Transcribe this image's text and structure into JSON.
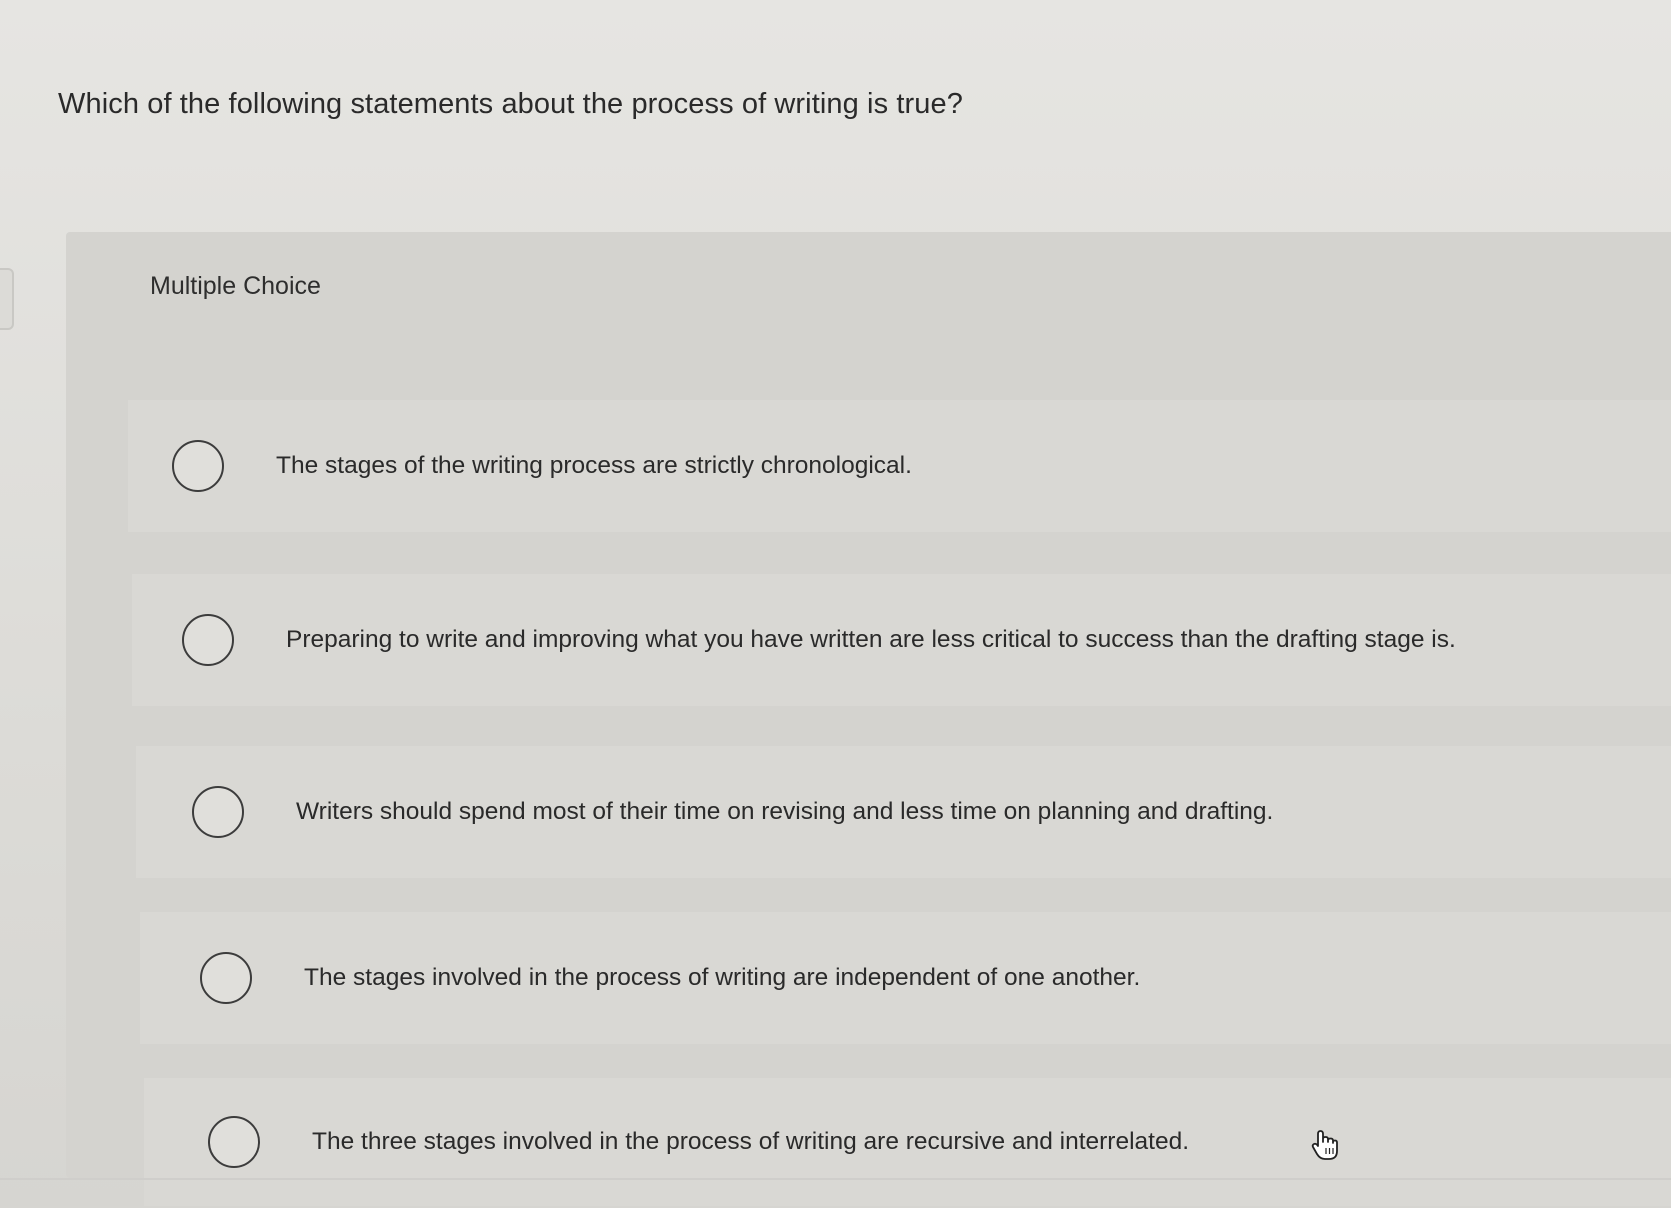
{
  "question": {
    "text": "Which of the following statements about the process of writing is true?"
  },
  "panel": {
    "label": "Multiple Choice"
  },
  "options": [
    {
      "text": "The stages of the writing process are strictly chronological."
    },
    {
      "text": "Preparing to write and improving what you have written are less critical to success than the drafting stage is."
    },
    {
      "text": "Writers should spend most of their time on revising and less time on planning and drafting."
    },
    {
      "text": "The stages involved in the process of writing are independent of one another."
    },
    {
      "text": "The three stages involved in the process of writing are recursive and interrelated."
    }
  ],
  "icons": {
    "radio": "radio-unselected-icon",
    "cursor": "hand-pointer-cursor-icon"
  }
}
